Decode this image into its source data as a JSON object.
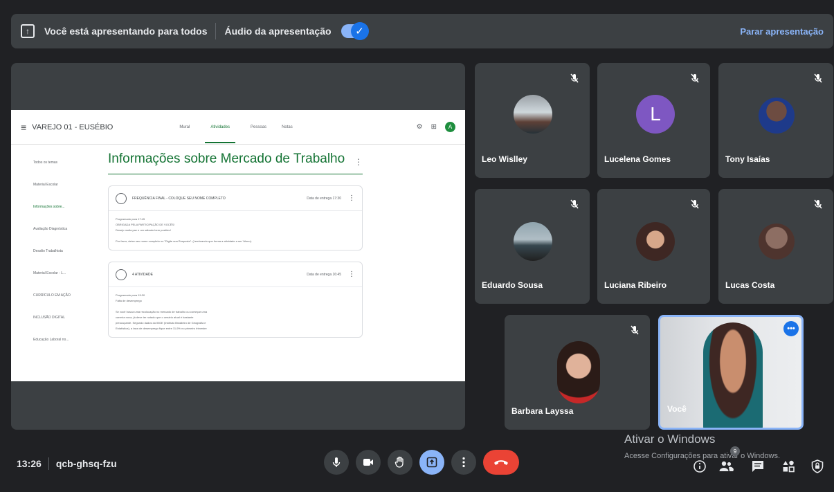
{
  "presentation_bar": {
    "text": "Você está apresentando para todos",
    "audio_label": "Áudio da apresentação",
    "stop_label": "Parar apresentação"
  },
  "shared_screen": {
    "class_name": "VAREJO 01 - EUSÉBIO",
    "tabs": [
      "Mural",
      "Atividades",
      "Pessoas",
      "Notas"
    ],
    "active_tab": "Atividades",
    "avatar_letter": "A",
    "topic_title": "Informações sobre Mercado de Trabalho",
    "side_items": [
      "Todos os temas",
      "Material Escolar",
      "Informações sobre...",
      "Avaliação Diagnóstica",
      "Desafio Trabalhista",
      "Material Escolar - L...",
      "CURRÍCULO EM AÇÃO",
      "INCLUSÃO DIGITAL",
      "Educação Laboral no..."
    ],
    "cards": [
      {
        "title": "FREQUÊNCIA FINAL - COLOQUE SEU NOME COMPLETO",
        "date": "Data de entrega 17:30",
        "lines": [
          "Programado para 17:45",
          "OBRIGADA PELA PARTICIPAÇÃO DE VOCÊS!",
          "Desejo muita paz e um sábado bem positivo!",
          "Por favor, deixe seu nome completo no \"Digite sua Resposta\". (Lembrando que forma a atividade a ser 'Aluno)."
        ]
      },
      {
        "title": "4 ATIVIDADE",
        "date": "Data de entrega 16:45",
        "lines": [
          "Programado para 15:30",
          "Falta de desemprego",
          "Se você busca uma recolocação no mercado de trabalho ou começar uma",
          "carreira nova, já deve ter notado que o cenário atual é bastante",
          "preocupante. Segundo dados do IBGE (Instituto Brasileiro de Geografia e",
          "Estatística), a taxa de desemprego fique entre 11,9% no primeiro trimestre"
        ]
      }
    ]
  },
  "participants": [
    {
      "name": "Leo Wislley",
      "muted": true
    },
    {
      "name": "Lucelena Gomes",
      "muted": true,
      "avatar_letter": "L",
      "avatar_color": "#7e57c2"
    },
    {
      "name": "Tony Isaías",
      "muted": true
    },
    {
      "name": "Eduardo Sousa",
      "muted": true
    },
    {
      "name": "Luciana Ribeiro",
      "muted": true
    },
    {
      "name": "Lucas Costa",
      "muted": true
    },
    {
      "name": "Barbara Layssa",
      "muted": true
    },
    {
      "name": "Você",
      "muted": false
    }
  ],
  "meeting": {
    "time": "13:26",
    "code": "qcb-ghsq-fzu"
  },
  "controls": [
    "microphone-icon",
    "camera-icon",
    "raise-hand-icon",
    "present-icon",
    "more-options-icon",
    "end-call-icon"
  ],
  "right_toolbar": {
    "people_badge": "9",
    "icons": [
      "info-icon",
      "people-icon",
      "chat-icon",
      "activities-icon",
      "host-controls-icon"
    ]
  },
  "windows_watermark": {
    "title": "Ativar o Windows",
    "subtitle": "Acesse Configurações para ativar o Windows."
  },
  "colors": {
    "background": "#202124",
    "tile": "#3c4043",
    "accent_blue": "#8ab4f8",
    "end_call_red": "#ea4335",
    "classroom_green": "#137333"
  }
}
